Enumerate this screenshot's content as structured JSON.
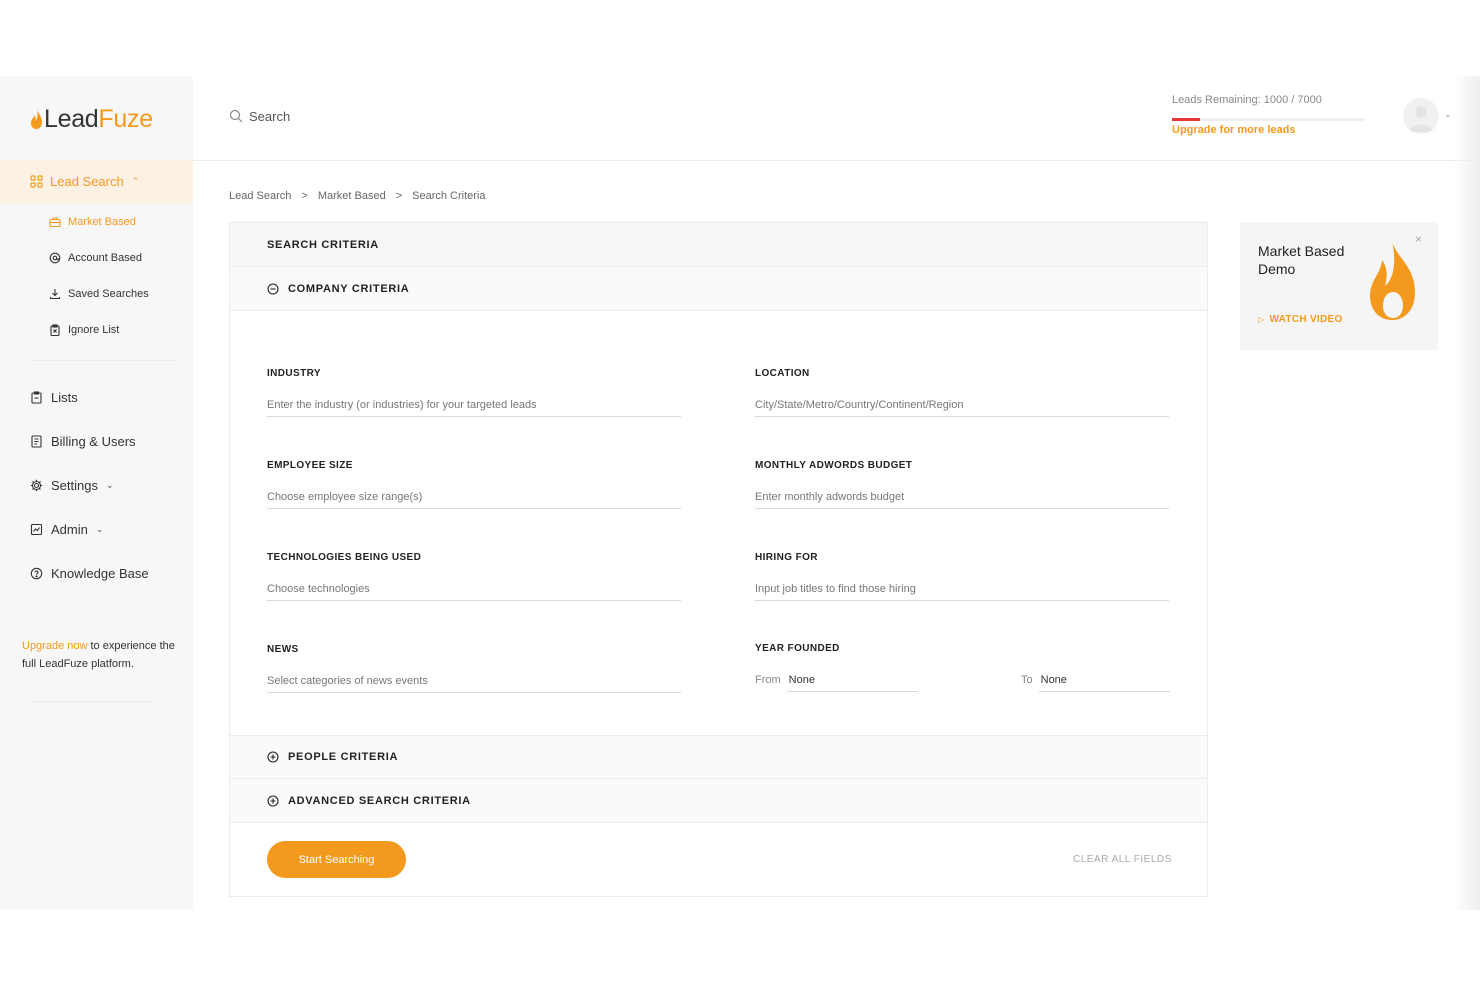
{
  "brand": {
    "name_part1": "Lead",
    "name_part2": "Fuze",
    "accent": "#f39a1e"
  },
  "sidebar": {
    "lead_search": {
      "label": "Lead Search"
    },
    "sub_items": [
      {
        "label": "Market Based",
        "icon": "briefcase-icon",
        "active": true
      },
      {
        "label": "Account Based",
        "icon": "at-sign-icon",
        "active": false
      },
      {
        "label": "Saved Searches",
        "icon": "download-icon",
        "active": false
      },
      {
        "label": "Ignore List",
        "icon": "clipboard-x-icon",
        "active": false
      }
    ],
    "items": [
      {
        "label": "Lists",
        "icon": "clipboard-icon"
      },
      {
        "label": "Billing & Users",
        "icon": "receipt-icon"
      },
      {
        "label": "Settings",
        "icon": "gear-icon",
        "has_dropdown": true
      },
      {
        "label": "Admin",
        "icon": "chart-icon",
        "has_dropdown": true
      },
      {
        "label": "Knowledge Base",
        "icon": "help-circle-icon"
      }
    ],
    "upgrade": {
      "link": "Upgrade now",
      "rest": " to experience the full LeadFuze platform."
    }
  },
  "header": {
    "search_placeholder": "Search",
    "leads_remaining": "Leads Remaining: 1000 / 7000",
    "leads_progress_fraction": 0.143,
    "upgrade_link": "Upgrade for more leads"
  },
  "breadcrumb": [
    "Lead Search",
    "Market Based",
    "Search Criteria"
  ],
  "criteria": {
    "title": "SEARCH CRITERIA",
    "company_section": "COMPANY CRITERIA",
    "people_section": "PEOPLE CRITERIA",
    "advanced_section": "ADVANCED SEARCH CRITERIA",
    "fields": {
      "industry": {
        "label": "INDUSTRY",
        "placeholder": "Enter the industry (or industries) for your targeted leads"
      },
      "location": {
        "label": "LOCATION",
        "placeholder": "City/State/Metro/Country/Continent/Region"
      },
      "employee_size": {
        "label": "EMPLOYEE SIZE",
        "placeholder": "Choose employee size range(s)"
      },
      "adwords": {
        "label": "MONTHLY ADWORDS BUDGET",
        "placeholder": "Enter monthly adwords budget"
      },
      "technologies": {
        "label": "TECHNOLOGIES BEING USED",
        "placeholder": "Choose technologies"
      },
      "hiring": {
        "label": "HIRING FOR",
        "placeholder": "Input job titles to find those hiring"
      },
      "news": {
        "label": "NEWS",
        "placeholder": "Select categories of news events"
      },
      "year_founded": {
        "label": "YEAR FOUNDED",
        "from_label": "From",
        "from_value": "None",
        "to_label": "To",
        "to_value": "None"
      }
    },
    "start_button": "Start Searching",
    "clear_button": "CLEAR ALL FIELDS"
  },
  "demo": {
    "title": "Market Based Demo",
    "watch": "WATCH VIDEO",
    "close": "×"
  }
}
